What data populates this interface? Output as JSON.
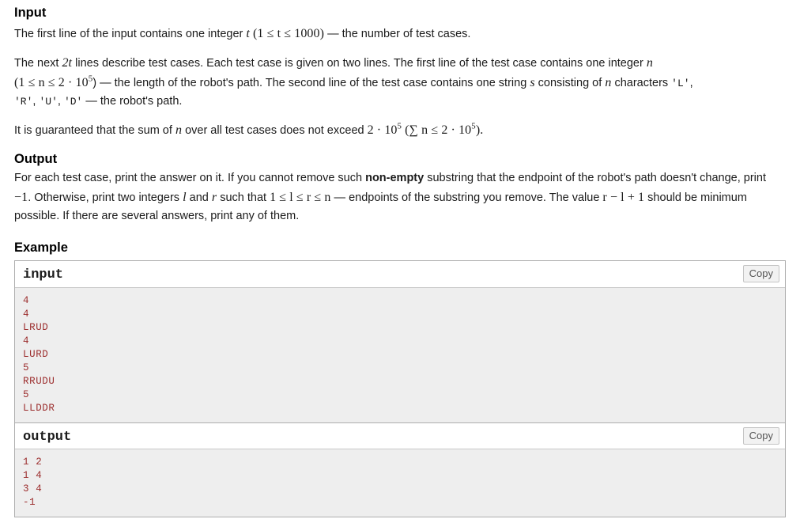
{
  "input_section": {
    "title": "Input",
    "p1_pre": "The first line of the input contains one integer ",
    "p1_var": "t",
    "p1_paren": "(1 ≤ t ≤ 1000)",
    "p1_post": " — the number of test cases.",
    "p2_a": "The next ",
    "p2_m1": "2t",
    "p2_b": " lines describe test cases. Each test case is given on two lines. The first line of the test case contains one integer ",
    "p2_m2": "n",
    "p2_c": "(1 ≤ n ≤ 2 · 10",
    "p2_c_exp": "5",
    "p2_d": ") — the length of the robot's path. The second line of the test case contains one string ",
    "p2_m3": "s",
    "p2_e": " consisting of ",
    "p2_m4": "n",
    "p2_f": " characters ",
    "p2_ch1": "'L'",
    "p2_g": ", ",
    "p2_ch2": "'R'",
    "p2_ch3": "'U'",
    "p2_ch4": "'D'",
    "p2_h": " — the robot's path.",
    "p3_a": "It is guaranteed that the sum of ",
    "p3_m1": "n",
    "p3_b": " over all test cases does not exceed ",
    "p3_m2": "2 · 10",
    "p3_m2_exp": "5",
    "p3_c": " (∑ n ≤ 2 · 10",
    "p3_c_exp": "5",
    "p3_d": ")."
  },
  "output_section": {
    "title": "Output",
    "t1": "For each test case, print the answer on it. If you cannot remove such ",
    "bold1": "non-empty",
    "t2": " substring that the endpoint of the robot's path doesn't change, print ",
    "m_neg1": "−1",
    "t3": ". Otherwise, print two integers ",
    "m_l": "l",
    "t4": " and ",
    "m_r": "r",
    "t5": " such that ",
    "m_chain": "1 ≤ l ≤ r ≤ n",
    "t6": " — endpoints of the substring you remove. The value ",
    "m_expr": "r − l + 1",
    "t7": " should be minimum possible. If there are several answers, print any of them."
  },
  "example": {
    "title": "Example",
    "input": {
      "label": "input",
      "copy_label": "Copy",
      "content": "4\n4\nLRUD\n4\nLURD\n5\nRRUDU\n5\nLLDDR"
    },
    "output": {
      "label": "output",
      "copy_label": "Copy",
      "content": "1 2\n1 4\n3 4\n-1"
    }
  },
  "colors": {
    "code_text": "#9c2e2e",
    "code_bg": "#eeeeee",
    "border": "#adadad",
    "text": "#1b1b1b"
  }
}
